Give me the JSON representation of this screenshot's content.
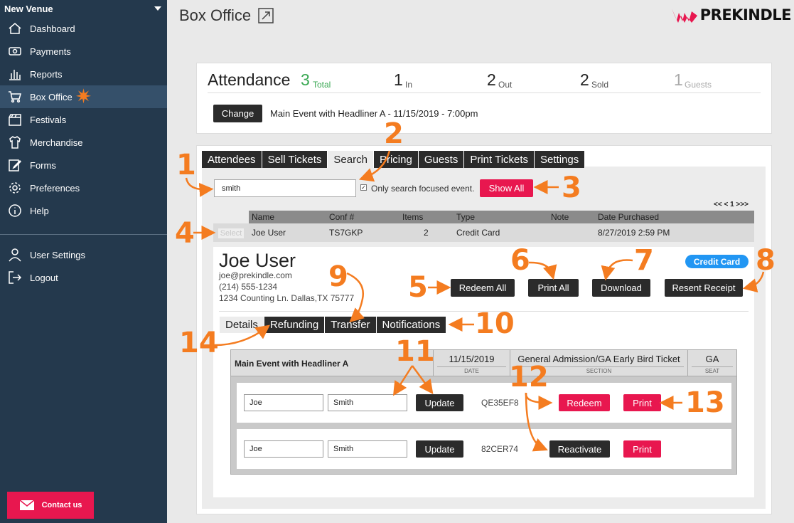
{
  "sidebar": {
    "venue": "New Venue",
    "items": [
      {
        "label": "Dashboard",
        "icon": "home-icon"
      },
      {
        "label": "Payments",
        "icon": "money-icon"
      },
      {
        "label": "Reports",
        "icon": "bar-chart-icon"
      },
      {
        "label": "Box Office",
        "icon": "cart-icon"
      },
      {
        "label": "Festivals",
        "icon": "clapperboard-icon"
      },
      {
        "label": "Merchandise",
        "icon": "shirt-icon"
      },
      {
        "label": "Forms",
        "icon": "edit-form-icon"
      },
      {
        "label": "Preferences",
        "icon": "gear-icon"
      },
      {
        "label": "Help",
        "icon": "info-icon"
      }
    ],
    "bottom_items": [
      {
        "label": "User Settings",
        "icon": "user-icon"
      },
      {
        "label": "Logout",
        "icon": "logout-icon"
      }
    ],
    "contact": "Contact us"
  },
  "header": {
    "title": "Box Office",
    "brand": "PREKINDLE"
  },
  "attendance": {
    "title": "Attendance",
    "total": "3",
    "total_label": "Total",
    "in": "1",
    "in_label": "In",
    "out": "2",
    "out_label": "Out",
    "sold": "2",
    "sold_label": "Sold",
    "guests": "1",
    "guests_label": "Guests",
    "change_label": "Change",
    "event": "Main Event with Headliner A - 11/15/2019 - 7:00pm"
  },
  "tabs": [
    "Attendees",
    "Sell Tickets",
    "Search",
    "Pricing",
    "Guests",
    "Print Tickets",
    "Settings"
  ],
  "search": {
    "value": "smith",
    "checkbox_label": "Only search focused event.",
    "show_all": "Show All",
    "pager": "<< < 1 >>>"
  },
  "results": {
    "headers": [
      "Name",
      "Conf #",
      "Items",
      "Type",
      "Note",
      "Date Purchased"
    ],
    "select_label": "Select",
    "row": {
      "name": "Joe User",
      "conf": "TS7GKP",
      "items": "2",
      "type": "Credit Card",
      "note": "",
      "date": "8/27/2019 2:59 PM"
    }
  },
  "customer": {
    "name": "Joe User",
    "email": "joe@prekindle.com",
    "phone": "(214) 555-1234",
    "address": "1234 Counting Ln. Dallas,TX 75777",
    "payment_badge": "Credit Card",
    "buttons": {
      "redeem_all": "Redeem All",
      "print_all": "Print All",
      "download": "Download",
      "resend": "Resent Receipt"
    }
  },
  "subtabs": [
    "Details",
    "Refunding",
    "Transfer",
    "Notifications"
  ],
  "ticket_group": {
    "event": "Main Event with Headliner A",
    "date": "11/15/2019",
    "date_label": "DATE",
    "section": "General Admission/GA Early Bird Ticket",
    "section_label": "SECTION",
    "seat": "GA",
    "seat_label": "SEAT",
    "tickets": [
      {
        "first": "Joe",
        "last": "Smith",
        "update": "Update",
        "code": "QE35EF8",
        "action": "Redeem",
        "print": "Print"
      },
      {
        "first": "Joe",
        "last": "Smith",
        "update": "Update",
        "code": "82CER74",
        "action": "Reactivate",
        "print": "Print"
      }
    ]
  },
  "annotations": [
    "1",
    "2",
    "3",
    "4",
    "5",
    "6",
    "7",
    "8",
    "9",
    "10",
    "11",
    "12",
    "13",
    "14"
  ],
  "colors": {
    "sidebar": "#24394d",
    "accent_pink": "#e8174f",
    "annotation": "#f47c20",
    "total_green": "#3aa853",
    "badge_blue": "#2196f3"
  }
}
